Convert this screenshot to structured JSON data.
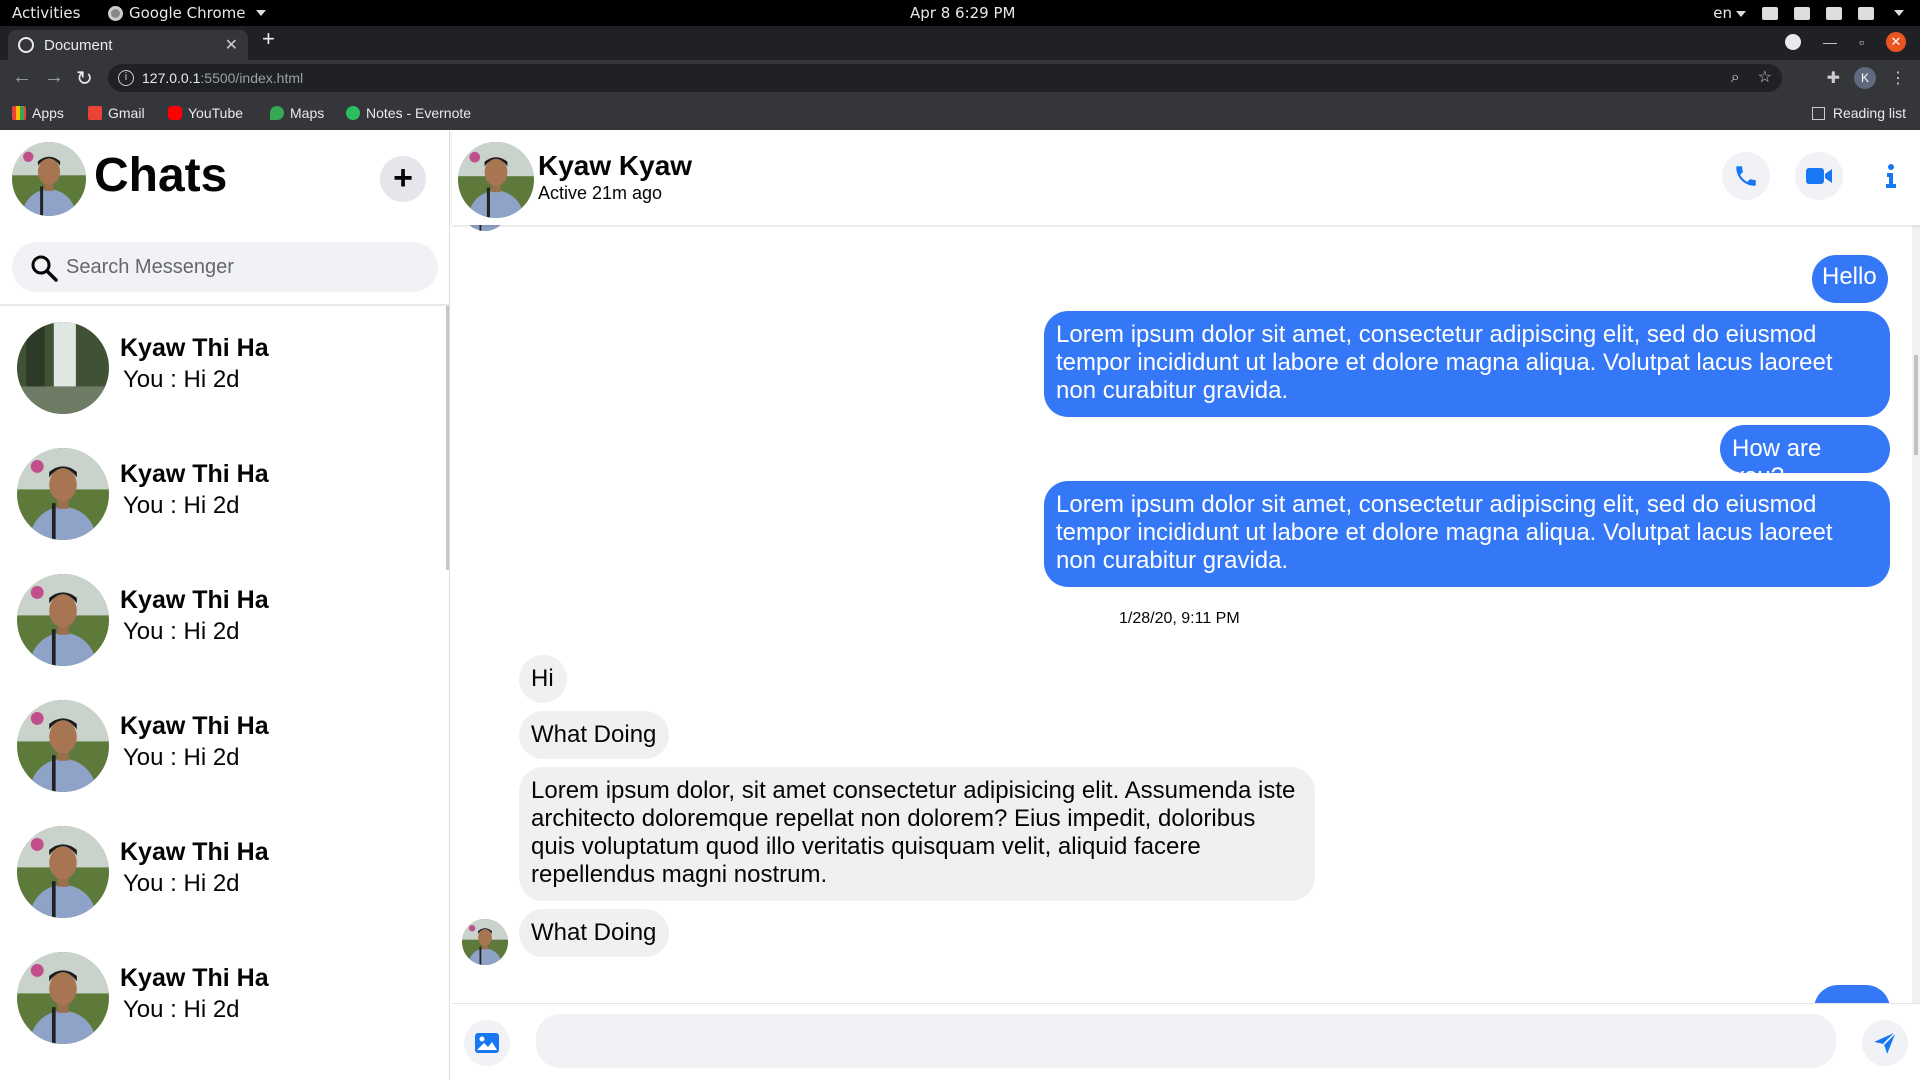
{
  "os": {
    "activities": "Activities",
    "app_name": "Google Chrome",
    "clock": "Apr 8  6:29 PM",
    "lang": "en"
  },
  "browser": {
    "tab_title": "Document",
    "url_host": "127.0.0.1",
    "url_path": ":5500/index.html",
    "profile_initial": "K",
    "bookmarks": [
      "Apps",
      "Gmail",
      "YouTube",
      "Maps",
      "Notes - Evernote"
    ],
    "reading_list": "Reading list"
  },
  "sidebar": {
    "title": "Chats",
    "new_button": "+",
    "search_placeholder": "Search Messenger",
    "chats": [
      {
        "name": "Kyaw Thi Ha",
        "preview": "You : Hi 2d",
        "avatar": "waterfall"
      },
      {
        "name": "Kyaw Thi Ha",
        "preview": "You : Hi 2d",
        "avatar": "person"
      },
      {
        "name": "Kyaw Thi Ha",
        "preview": "You : Hi 2d",
        "avatar": "person"
      },
      {
        "name": "Kyaw Thi Ha",
        "preview": "You : Hi 2d",
        "avatar": "person"
      },
      {
        "name": "Kyaw Thi Ha",
        "preview": "You : Hi 2d",
        "avatar": "person"
      },
      {
        "name": "Kyaw Thi Ha",
        "preview": "You : Hi 2d",
        "avatar": "person"
      }
    ]
  },
  "conversation": {
    "peer_name": "Kyaw Kyaw",
    "peer_status": "Active 21m ago",
    "messages_out_1": "Hello",
    "messages_out_2": "Lorem ipsum dolor sit amet, consectetur adipiscing elit, sed do eiusmod tempor incididunt ut labore et dolore magna aliqua. Volutpat lacus laoreet non curabitur gravida.",
    "messages_out_3": "How are you?",
    "messages_out_4": "Lorem ipsum dolor sit amet, consectetur adipiscing elit, sed do eiusmod tempor incididunt ut labore et dolore magna aliqua. Volutpat lacus laoreet non curabitur gravida.",
    "timestamp": "1/28/20, 9:11 PM",
    "messages_in_1": "Hi",
    "messages_in_2": "What Doing",
    "messages_in_3": "Lorem ipsum dolor, sit amet consectetur adipisicing elit. Assumenda iste architecto doloremque repellat non dolorem? Eius impedit, doloribus quis voluptatum quod illo veritatis quisquam velit, aliquid facere repellendus magni nostrum.",
    "messages_in_4": "What Doing",
    "composer_value": ""
  },
  "colors": {
    "outgoing_bubble": "#3578f7",
    "incoming_bubble": "#f0f0f2",
    "accent_icon": "#1877f2"
  },
  "icons": [
    "phone-icon",
    "video-camera-icon",
    "info-icon",
    "image-icon",
    "send-icon",
    "search-icon",
    "plus-icon"
  ]
}
